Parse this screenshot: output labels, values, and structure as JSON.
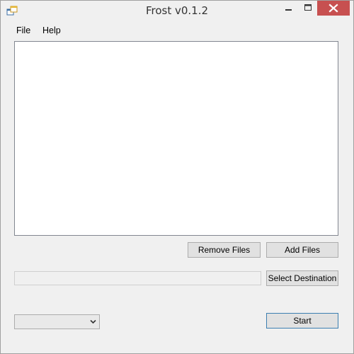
{
  "window": {
    "title": "Frost v0.1.2"
  },
  "menu": {
    "file": "File",
    "help": "Help"
  },
  "file_list": {
    "items": []
  },
  "buttons": {
    "remove_files": "Remove Files",
    "add_files": "Add Files",
    "select_destination": "Select Destination",
    "start": "Start"
  },
  "destination": {
    "value": ""
  },
  "mode_combo": {
    "selected": ""
  },
  "colors": {
    "close_button": "#c75050",
    "window_background": "#f0f0f0",
    "list_background": "#ffffff",
    "default_button_border": "#3c7fb1"
  },
  "icons": {
    "app": "app-window-icon",
    "minimize": "minimize-icon",
    "maximize": "maximize-icon",
    "close": "close-icon",
    "dropdown": "chevron-down-icon"
  }
}
